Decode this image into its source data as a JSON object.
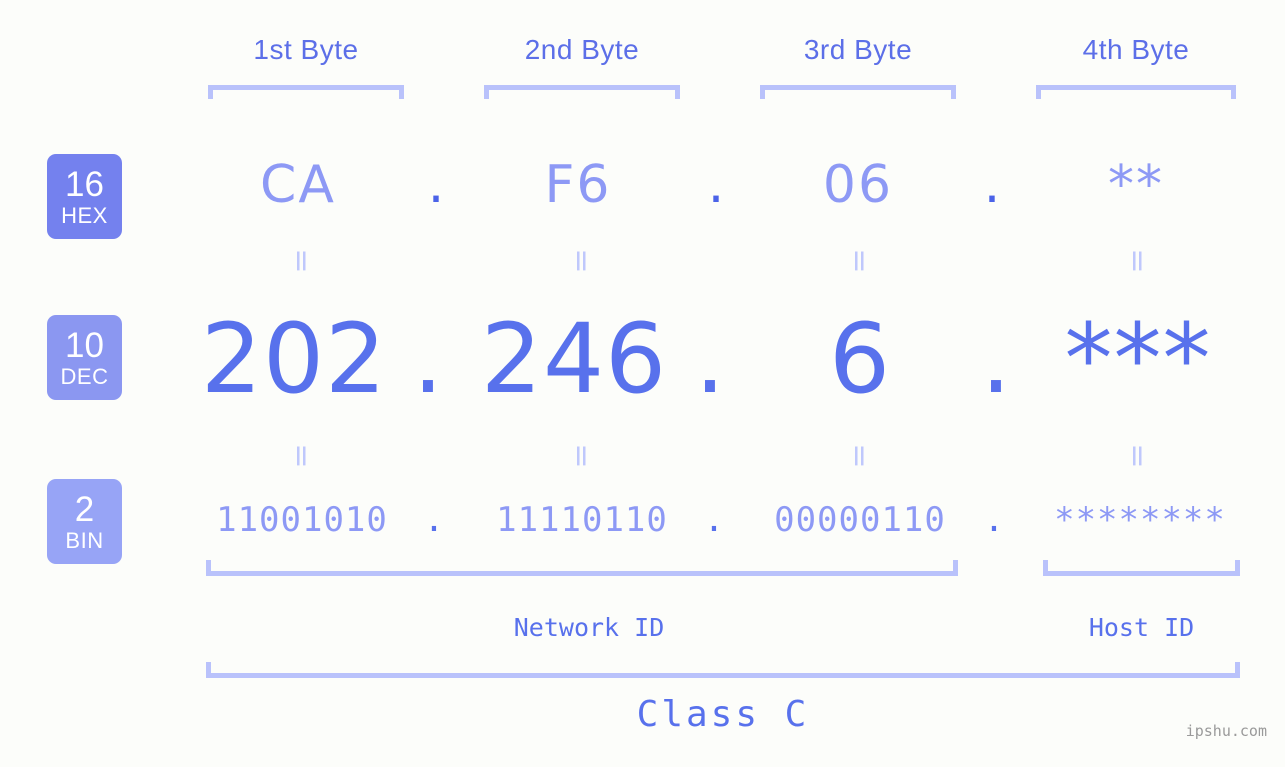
{
  "headers": [
    {
      "label": "1st Byte"
    },
    {
      "label": "2nd Byte"
    },
    {
      "label": "3rd Byte"
    },
    {
      "label": "4th Byte"
    }
  ],
  "bases": [
    {
      "num": "16",
      "name": "HEX",
      "color": "#7481ee"
    },
    {
      "num": "10",
      "name": "DEC",
      "color": "#8b97f1"
    },
    {
      "num": "2",
      "name": "BIN",
      "color": "#97a4f6"
    }
  ],
  "rows": {
    "hex": {
      "values": [
        "CA",
        "F6",
        "06",
        "**"
      ],
      "separators": [
        ".",
        ".",
        "."
      ]
    },
    "dec": {
      "values": [
        "202",
        "246",
        "6",
        "***"
      ],
      "separators": [
        ".",
        ".",
        "."
      ]
    },
    "bin": {
      "values": [
        "11001010",
        "11110110",
        "00000110",
        "********"
      ],
      "separators": [
        ".",
        ".",
        "."
      ]
    }
  },
  "equals_glyph": "=",
  "sections": {
    "network_id": "Network ID",
    "host_id": "Host ID",
    "class": "Class C"
  },
  "watermark": "ipshu.com",
  "colors": {
    "background": "#fcfdfa",
    "accent": "#5871ec",
    "light_accent": "#8d99f5",
    "bracket": "#b9c2fb"
  }
}
